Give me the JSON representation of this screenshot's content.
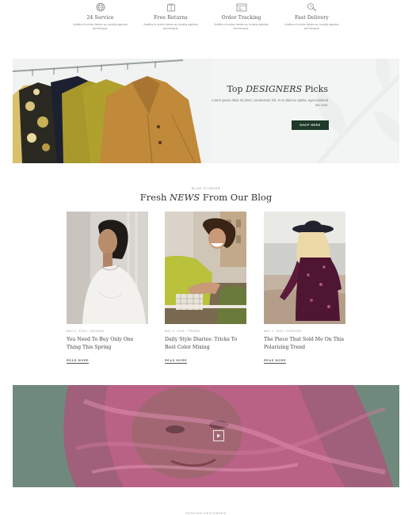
{
  "features": [
    {
      "title": "24 Service",
      "desc": "Aneltus et moles fames ac, turpiriy egestos sed tempus.",
      "icon": "globe-icon"
    },
    {
      "title": "Free Returns",
      "desc": "Aneltus et moles fames ac, turpiriy egestos sed tempus.",
      "icon": "gift-box-icon"
    },
    {
      "title": "Order Tracking",
      "desc": "Aneltus et moles fames ac, turpiriy egestos sed tempus.",
      "icon": "calendar-icon"
    },
    {
      "title": "Fast Delivery",
      "desc": "Aneltus et moles fames ac, turpiriy egestos sed tempus.",
      "icon": "delivery-icon"
    }
  ],
  "designers_banner": {
    "title_prefix": "Top",
    "title_emphasis": "DESIGNERS",
    "title_suffix": "Picks",
    "description": "Lorem ipsum dolor sit amet, consectetur elit. In ut ullamco ripeks, eget euismod nec erat.",
    "button_label": "SHOP HERE"
  },
  "blog": {
    "eyebrow": "BLOG STORIES",
    "title_prefix": "Fresh",
    "title_emphasis": "NEWS",
    "title_suffix": "From Our Blog",
    "posts": [
      {
        "meta": "MAY 2, 2024 / FASHION",
        "title": "You Need To Buy Only One Thing This Spring",
        "read_more": "READ MORE"
      },
      {
        "meta": "MAY 2, 2024 / TRAVEL",
        "title": "Daily Style Diaries: Tricks To Best Color Mixing",
        "read_more": "READ MORE"
      },
      {
        "meta": "MAY 2, 2024 / FASHION",
        "title": "The Piece That Sold Me On This Polarizing Trend",
        "read_more": "READ MORE"
      }
    ]
  },
  "video": {
    "icon": "play-icon"
  },
  "footer": {
    "label": "FASHION DESIGNERS"
  },
  "colors": {
    "accent": "#1e3a28",
    "video_bg": "#6f8a7c"
  }
}
